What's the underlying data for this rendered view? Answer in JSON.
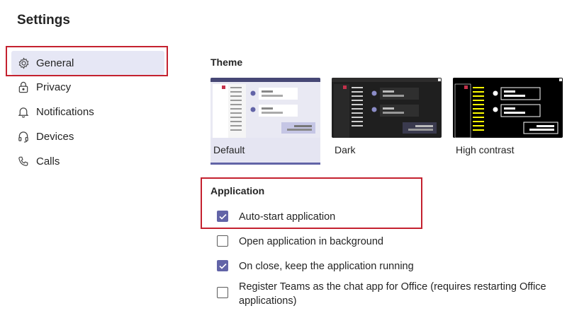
{
  "page": {
    "title": "Settings"
  },
  "sidebar": {
    "items": [
      {
        "label": "General",
        "icon": "gear-icon",
        "active": true
      },
      {
        "label": "Privacy",
        "icon": "lock-icon",
        "active": false
      },
      {
        "label": "Notifications",
        "icon": "bell-icon",
        "active": false
      },
      {
        "label": "Devices",
        "icon": "headset-icon",
        "active": false
      },
      {
        "label": "Calls",
        "icon": "phone-icon",
        "active": false
      }
    ]
  },
  "theme": {
    "heading": "Theme",
    "options": [
      {
        "label": "Default",
        "selected": true
      },
      {
        "label": "Dark",
        "selected": false
      },
      {
        "label": "High contrast",
        "selected": false
      }
    ]
  },
  "application": {
    "heading": "Application",
    "options": [
      {
        "label": "Auto-start application",
        "checked": true
      },
      {
        "label": "Open application in background",
        "checked": false
      },
      {
        "label": "On close, keep the application running",
        "checked": true
      },
      {
        "label": "Register Teams as the chat app for Office (requires restarting Office applications)",
        "checked": false
      }
    ]
  },
  "colors": {
    "accent": "#6264a7",
    "highlight_border": "#c4212f",
    "active_nav_bg": "#e6e7f5",
    "high_contrast_accent": "#ffff00"
  }
}
